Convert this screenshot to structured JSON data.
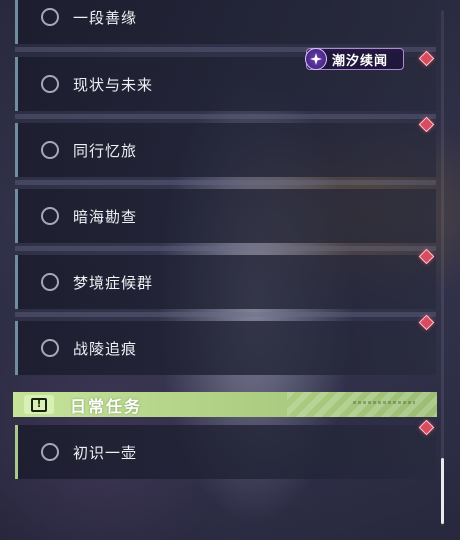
{
  "quest_list": {
    "items": [
      {
        "label": "一段善缘"
      },
      {
        "label": "现状与未来"
      },
      {
        "label": "同行忆旅"
      },
      {
        "label": "暗海勘查"
      },
      {
        "label": "梦境症候群"
      },
      {
        "label": "战陵追痕"
      }
    ],
    "event_badge": {
      "label": "潮汐续闻"
    },
    "daily_section": {
      "title": "日常任务",
      "icon_glyph": "!",
      "items": [
        {
          "label": "初识一壶"
        }
      ]
    }
  },
  "colors": {
    "accent_daily": "#aecf83",
    "notification_diamond": "#d94b5e",
    "item_border": "#6f8fa0",
    "badge_border": "#b08ad8"
  },
  "icons": [
    "ring-icon",
    "diamond-notification-icon",
    "alert-icon",
    "star-badge-icon"
  ]
}
